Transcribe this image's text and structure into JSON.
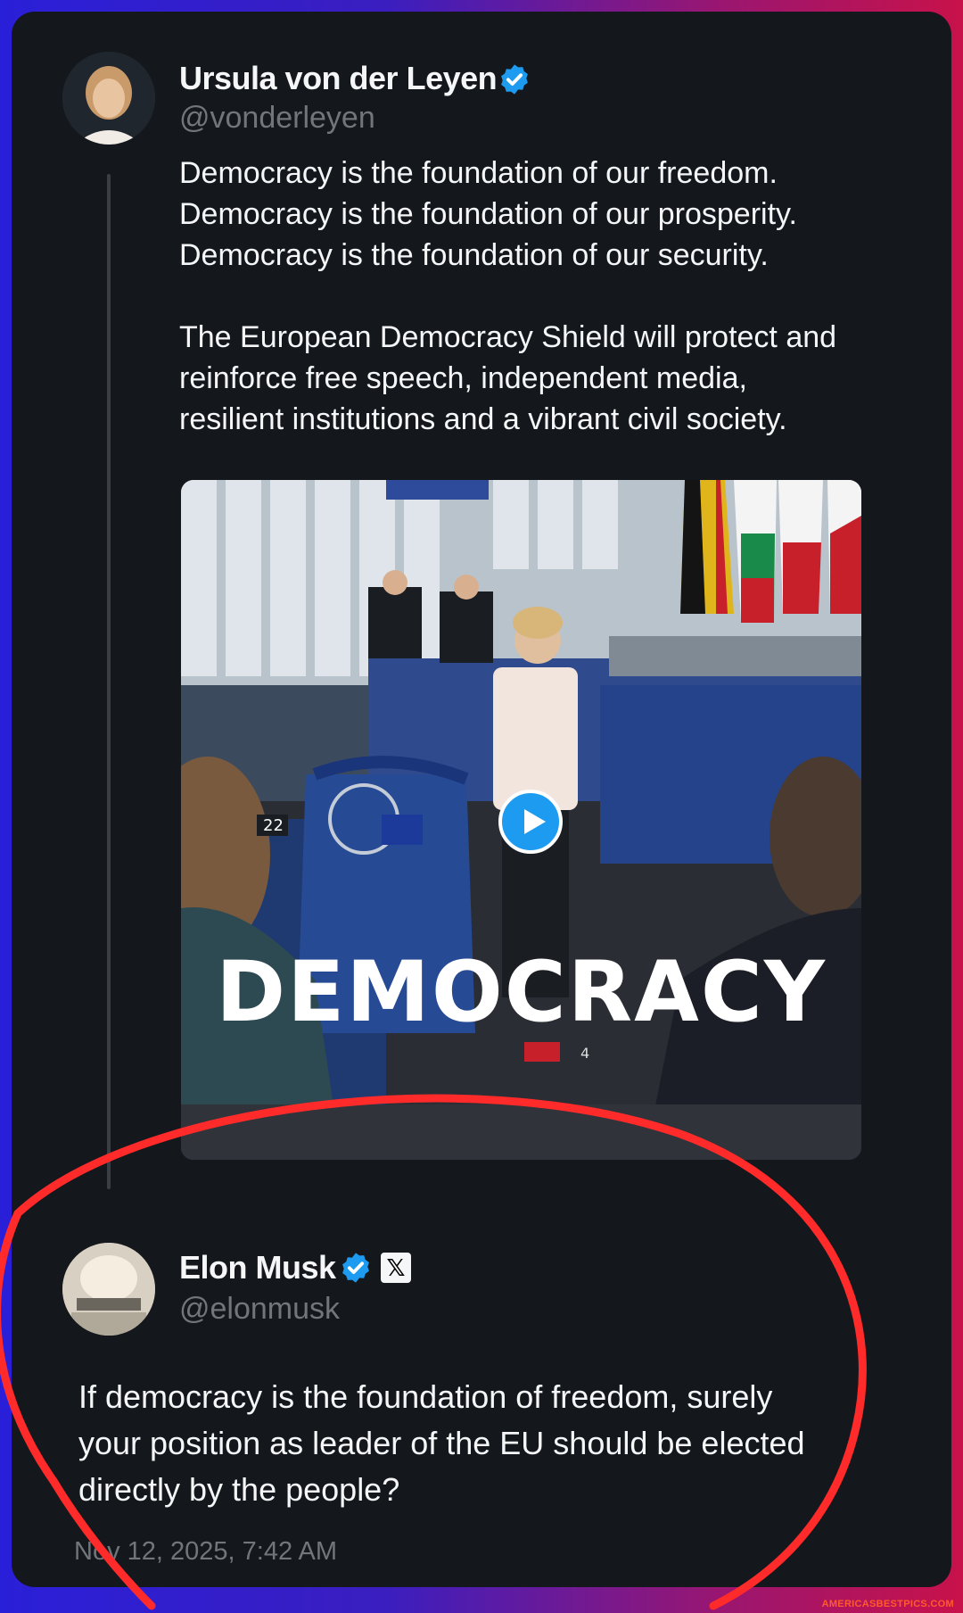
{
  "colors": {
    "card_bg": "#14171c",
    "text": "#f5f6f7",
    "muted": "#71767b",
    "verified": "#1d9bf0",
    "annotation_circle": "#ff2a2a"
  },
  "original_post": {
    "author_name": "Ursula von der Leyen",
    "author_handle": "@vonderleyen",
    "verified_icon": "verified-badge-icon",
    "text_lines": [
      "Democracy is the foundation of our freedom.",
      "Democracy is the foundation of our prosperity.",
      "Democracy is the foundation of our security.",
      "",
      "The European Democracy Shield will protect and",
      "reinforce free speech, independent media,",
      "resilient institutions and a vibrant civil society."
    ],
    "media": {
      "overlay_text": "DEMOCRACY",
      "seat_number": "22",
      "seat_number_2": "4",
      "play_icon": "play-icon"
    }
  },
  "reply": {
    "author_name": "Elon Musk",
    "author_handle": "@elonmusk",
    "verified_icon": "verified-badge-icon",
    "affiliation_badge": "𝕏",
    "text_lines": [
      "If democracy is the foundation of freedom, surely",
      "your position as leader of the EU should be elected",
      "directly by the people?"
    ],
    "timestamp": "Nov 12, 2025, 7:42 AM"
  },
  "watermark": "AMERICASBESTPICS.COM"
}
